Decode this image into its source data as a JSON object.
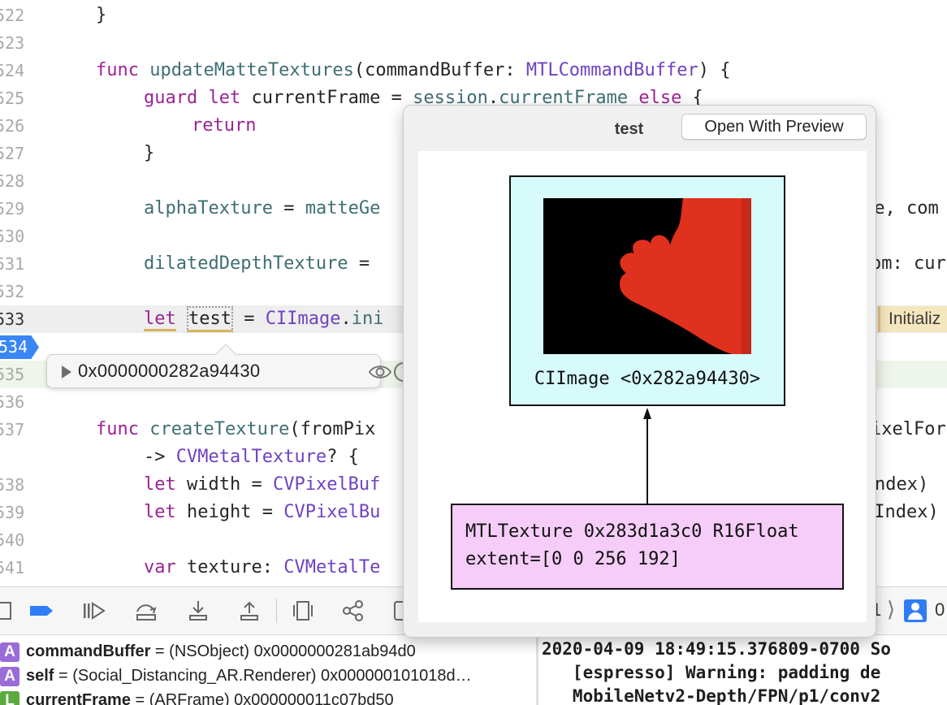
{
  "editor": {
    "line_numbers": [
      "522",
      "523",
      "524",
      "525",
      "526",
      "527",
      "528",
      "529",
      "530",
      "531",
      "532",
      "533",
      "534",
      "535",
      "536",
      "537",
      "",
      "538",
      "539",
      "540",
      "541"
    ],
    "breakpoint_line": "534",
    "lines": {
      "l522": "}",
      "l524_kw": "func",
      "l524_fn": "updateMatteTextures",
      "l524_a": "(commandBuffer: ",
      "l524_ty": "MTLCommandBuffer",
      "l524_b": ") {",
      "l525_kw1": "guard",
      "l525_kw2": "let",
      "l525_a": " currentFrame = ",
      "l525_fn1": "session",
      "l525_dot": ".",
      "l525_fn2": "currentFrame",
      "l525_kw3": "else",
      "l525_b": " {",
      "l526_kw": "return",
      "l527": "}",
      "l529_fn": "alphaTexture",
      "l529_a": " = ",
      "l529_fn2": "matteGe",
      "l529_tail": "ne, com",
      "l531_fn": "dilatedDepthTexture",
      "l531_a": " = ",
      "l531_tail": "om: cur",
      "l533_kw": "let",
      "l533_var": "test",
      "l533_a": " = ",
      "l533_ty": "CIImage",
      "l533_b": ".",
      "l533_fn": "ini",
      "l537_kw": "func",
      "l537_fn": "createTexture",
      "l537_a": "(fromPix",
      "l537_tail": "ixelFor",
      "l537b_a": "-> ",
      "l537b_ty": "CVMetalTexture",
      "l537b_b": "? {",
      "l538_kw": "let",
      "l538_a": " width = ",
      "l538_ty": "CVPixelBuf",
      "l538_tail": "ndex)",
      "l539_kw": "let",
      "l539_a": " height = ",
      "l539_ty": "CVPixelBu",
      "l539_tail": "eIndex)",
      "l541_kw": "var",
      "l541_a": " texture: ",
      "l541_ty": "CVMetalTe"
    },
    "issue_label": "Initializ"
  },
  "value_tip": {
    "value": "0x0000000282a94430",
    "eye_icon": "eye-icon",
    "info_icon": "info-icon"
  },
  "quick_look": {
    "title": "test",
    "open_button": "Open With Preview",
    "ci_label": "CIImage <0x282a94430>",
    "mtl_line1": "MTLTexture 0x283d1a3c0 R16Float",
    "mtl_line2": "extent=[0 0 256 192]",
    "colors": {
      "matte_red": "#e0301e",
      "ci_fill": "#d7fafa",
      "mtl_fill": "#f5cdf8"
    }
  },
  "debug_bar": {
    "icons": [
      "sidebar-toggle-icon",
      "breakpoints-icon",
      "continue-icon",
      "step-over-icon",
      "step-into-icon",
      "step-out-icon",
      "debug-view-hierarchy-icon",
      "memory-graph-icon",
      "environment-overrides-icon"
    ],
    "crumb_number": "1",
    "crumb_zero": "0"
  },
  "variables": [
    {
      "kind": "A",
      "name": "commandBuffer",
      "value": " = (NSObject) 0x0000000281ab94d0"
    },
    {
      "kind": "A",
      "name": "self",
      "value": " = (Social_Distancing_AR.Renderer) 0x000000101018d…"
    },
    {
      "kind": "L",
      "name": "currentFrame",
      "value": " = (ARFrame) 0x000000011c07bd50"
    }
  ],
  "console": {
    "line1": "2020-04-09 18:49:15.376809-0700 So",
    "line2": "   [espresso] Warning: padding de",
    "line3": "   MobileNetv2-Depth/FPN/p1/conv2"
  },
  "accent": "#3a86f6"
}
